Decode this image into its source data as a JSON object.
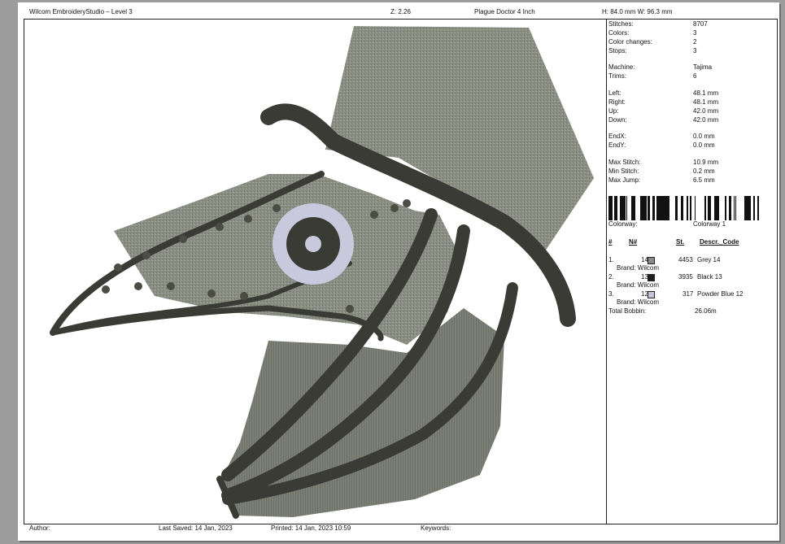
{
  "header": {
    "app_title": "Wilcom EmbroideryStudio – Level 3",
    "zoom": "Z: 2.26",
    "design_name": "Plague Doctor 4 Inch",
    "dimensions": "H: 84.0 mm  W: 96.3 mm"
  },
  "stats": [
    {
      "label": "Stitches:",
      "value": "8707"
    },
    {
      "label": "Colors:",
      "value": "3"
    },
    {
      "label": "Color changes:",
      "value": "2"
    },
    {
      "label": "Stops:",
      "value": "3"
    },
    {
      "label": "Machine:",
      "value": "Tajima"
    },
    {
      "label": "Trims:",
      "value": "6"
    },
    {
      "label": "Left:",
      "value": "48.1 mm"
    },
    {
      "label": "Right:",
      "value": "48.1 mm"
    },
    {
      "label": "Up:",
      "value": "42.0 mm"
    },
    {
      "label": "Down:",
      "value": "42.0 mm"
    },
    {
      "label": "EndX:",
      "value": "0.0 mm"
    },
    {
      "label": "EndY:",
      "value": "0.0 mm"
    },
    {
      "label": "Max Stitch:",
      "value": "10.9 mm"
    },
    {
      "label": "Min Stitch:",
      "value": "0.2 mm"
    },
    {
      "label": "Max Jump:",
      "value": "6.5 mm"
    }
  ],
  "colorway": {
    "label": "Colorway:",
    "value": "Colorway 1"
  },
  "color_table": {
    "headers": {
      "num": "#",
      "n": "N#",
      "st": "St.",
      "descr": "Descr._Code"
    },
    "rows": [
      {
        "num": "1.",
        "n": "14",
        "swatch": "#8c8c84",
        "st": "4453",
        "descr": "Grey 14",
        "brand": "Brand: Wilcom"
      },
      {
        "num": "2.",
        "n": "13",
        "swatch": "#1e1e1a",
        "st": "3935",
        "descr": "Black 13",
        "brand": "Brand: Wilcom"
      },
      {
        "num": "3.",
        "n": "12",
        "swatch": "#c5c6dc",
        "st": "317",
        "descr": "Powder Blue 12",
        "brand": "Brand: Wilcom"
      }
    ],
    "total_bobbin_label": "Total Bobbin:",
    "total_bobbin_value": "26.06m"
  },
  "footer": {
    "author": "Author:",
    "last_saved": "Last Saved: 14 Jan, 2023",
    "printed": "Printed: 14 Jan, 2023 10:59",
    "keywords": "Keywords:"
  },
  "colors": {
    "grey": "#8a8e82",
    "black": "#3a3b34",
    "powder_blue": "#c8c9dd"
  }
}
